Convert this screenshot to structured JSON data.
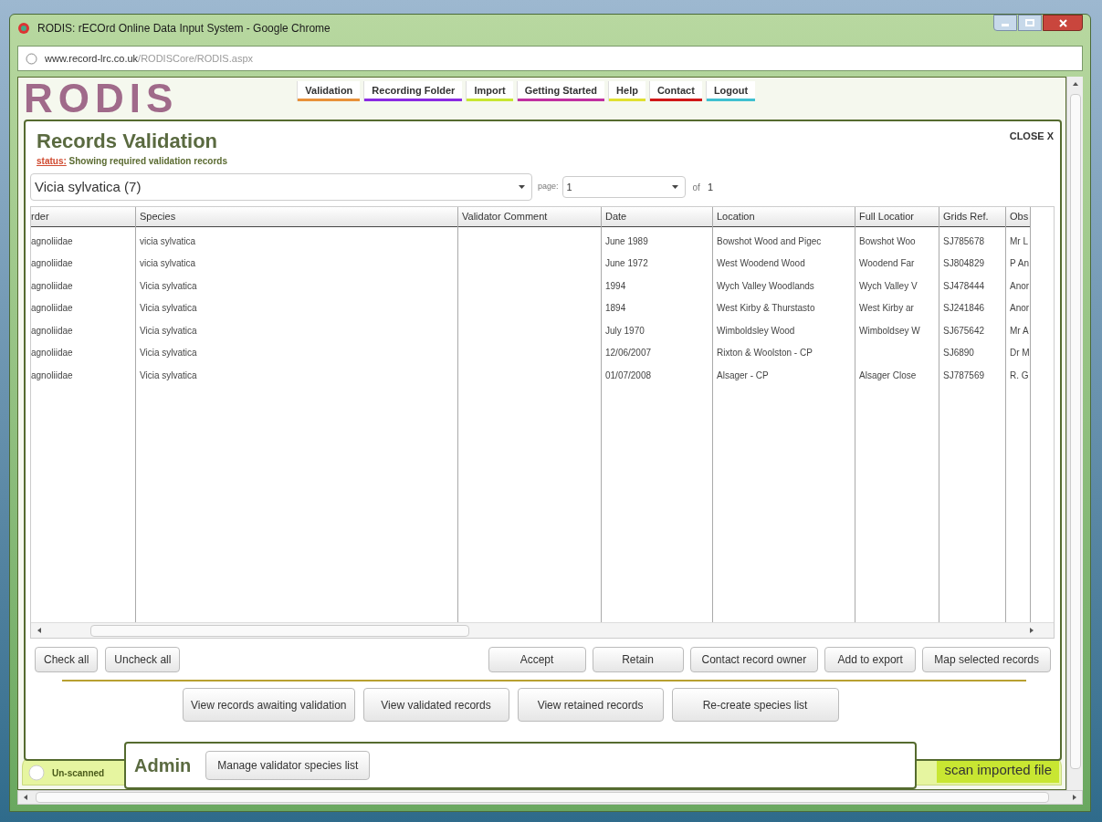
{
  "window": {
    "title": "RODIS: rECOrd Online Data Input System - Google Chrome"
  },
  "address_bar": {
    "host": "www.record-lrc.co.uk",
    "path": "/RODISCore/RODIS.aspx"
  },
  "logo": "RODIS",
  "nav": [
    {
      "label": "Validation",
      "color": "#e8913a"
    },
    {
      "label": "Recording Folder",
      "color": "#8a2be2"
    },
    {
      "label": "Import",
      "color": "#c8e632"
    },
    {
      "label": "Getting Started",
      "color": "#c030a0"
    },
    {
      "label": "Help",
      "color": "#e0e030"
    },
    {
      "label": "Contact",
      "color": "#d01818"
    },
    {
      "label": "Logout",
      "color": "#40c0d0"
    }
  ],
  "dialog": {
    "title": "Records Validation",
    "close": "CLOSE X",
    "status_label": "status:",
    "status": "Showing required validation records",
    "species_select": "Vicia sylvatica (7)",
    "page_label": "page:",
    "page_value": "1",
    "of_label": "of",
    "page_count": "1",
    "table": {
      "columns": [
        "rder",
        "Species",
        "Validator Comment",
        "Date",
        "Location",
        "Full Locatior",
        "Grids Ref.",
        "Obs"
      ],
      "rows": [
        [
          "agnoliidae",
          "vicia sylvatica",
          "",
          "June 1989",
          "Bowshot Wood and Pigec",
          "Bowshot Woo",
          "SJ785678",
          "Mr L"
        ],
        [
          "agnoliidae",
          "vicia sylvatica",
          "",
          "June 1972",
          "West Woodend Wood",
          "Woodend Far",
          "SJ804829",
          "P An"
        ],
        [
          "agnoliidae",
          "Vicia sylvatica",
          "",
          "1994",
          "Wych Valley Woodlands",
          "Wych Valley V",
          "SJ478444",
          "Anor"
        ],
        [
          "agnoliidae",
          "Vicia sylvatica",
          "",
          "1894",
          "West Kirby & Thurstasto",
          "West Kirby ar",
          "SJ241846",
          "Anor"
        ],
        [
          "agnoliidae",
          "Vicia sylvatica",
          "",
          "July 1970",
          "Wimboldsley Wood",
          "Wimboldsey W",
          "SJ675642",
          "Mr A"
        ],
        [
          "agnoliidae",
          "Vicia sylvatica",
          "",
          "12/06/2007",
          "Rixton & Woolston - CP",
          "",
          "SJ6890",
          "Dr M"
        ],
        [
          "agnoliidae",
          "Vicia sylvatica",
          "",
          "01/07/2008",
          "Alsager - CP",
          "Alsager Close",
          "SJ787569",
          "R. G"
        ]
      ]
    },
    "left_buttons": [
      "Check all",
      "Uncheck all"
    ],
    "right_buttons": [
      "Accept",
      "Retain",
      "Contact record owner",
      "Add to export",
      "Map selected records"
    ],
    "view_buttons": [
      "View records awaiting validation",
      "View validated records",
      "View retained records",
      "Re-create species list"
    ]
  },
  "admin": {
    "title": "Admin",
    "button": "Manage validator species list"
  },
  "footer": {
    "unscanned": "Un-scanned",
    "scan": "scan imported file"
  }
}
